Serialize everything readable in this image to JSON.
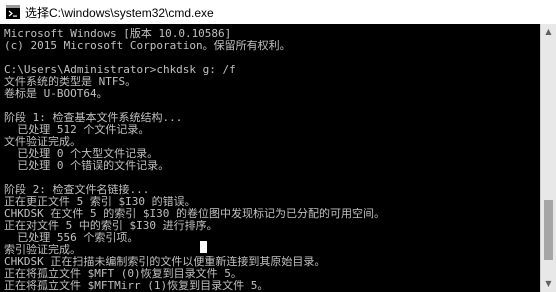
{
  "window": {
    "title": "选择C:\\windows\\system32\\cmd.exe",
    "icon": "cmd-icon"
  },
  "colors": {
    "titlebar_bg": "#ffffff",
    "title_text": "#000000",
    "console_bg": "#000000",
    "console_text": "#c0c0c0"
  },
  "console": {
    "lines": [
      "Microsoft Windows [版本 10.0.10586]",
      "(c) 2015 Microsoft Corporation。保留所有权利。",
      "",
      "C:\\Users\\Administrator>chkdsk g: /f",
      "文件系统的类型是 NTFS。",
      "卷标是 U-BOOT64。",
      "",
      "阶段 1: 检查基本文件系统结构...",
      "  已处理 512 个文件记录。",
      "文件验证完成。",
      "  已处理 0 个大型文件记录。",
      "  已处理 0 个错误的文件记录。",
      "",
      "阶段 2: 检查文件名链接...",
      "正在更正文件 5 索引 $I30 的错误。",
      "CHKDSK 在文件 5 的索引 $I30 的卷位图中发现标记为已分配的可用空间。",
      "正在对文件 5 中的索引 $I30 进行排序。",
      "  已处理 556 个索引项。",
      "索引验证完成。",
      "CHKDSK 正在扫描未编制索引的文件以便重新连接到其原始目录。",
      "正在将孤立文件 $MFT (0)恢复到目录文件 5。",
      "正在将孤立文件 $MFTMirr (1)恢复到目录文件 5。"
    ]
  },
  "scrollbar": {
    "up_icon": "scroll-up-arrow-icon",
    "down_icon": "scroll-down-arrow-icon"
  }
}
